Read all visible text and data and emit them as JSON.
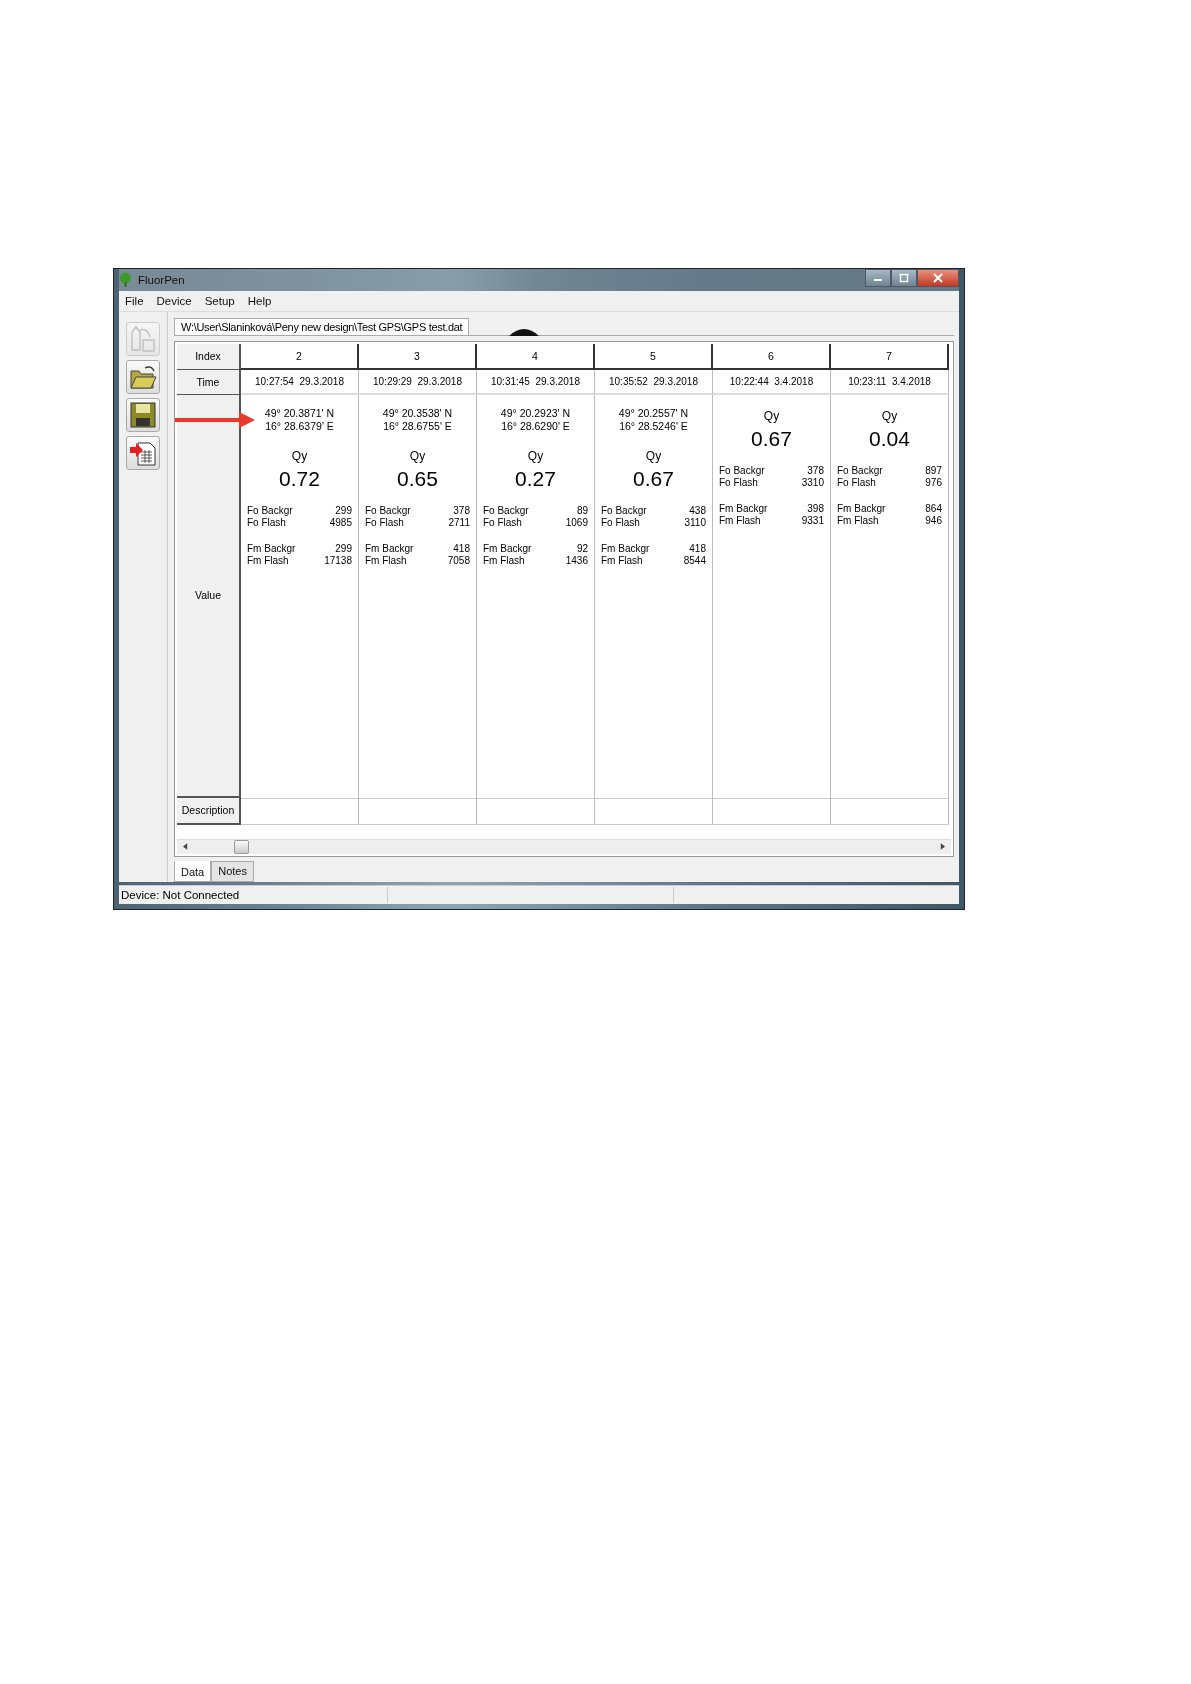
{
  "window": {
    "title": "FluorPen"
  },
  "menu": [
    "File",
    "Device",
    "Setup",
    "Help"
  ],
  "toolbar": [
    {
      "kind": "transfer",
      "disabled": true
    },
    {
      "kind": "open",
      "disabled": false
    },
    {
      "kind": "save",
      "disabled": false
    },
    {
      "kind": "export",
      "disabled": false
    }
  ],
  "file_tab": {
    "label": "W:\\User\\Slaninková\\Peny new design\\Test GPS\\GPS test.dat",
    "selected": true
  },
  "table": {
    "row_headers": {
      "index": "Index",
      "time": "Time",
      "value": "Value",
      "description": "Description"
    },
    "columns": [
      {
        "index": "2",
        "time": "10:27:54  29.3.2018",
        "gps": [
          "49° 20.3871' N",
          "16° 28.6379' E"
        ],
        "arrow": true,
        "qy_label": "Qy",
        "qy": "0.72",
        "groups": [
          [
            {
              "label": "Fo Backgr",
              "value": "299"
            },
            {
              "label": "Fo Flash",
              "value": "4985"
            }
          ],
          [
            {
              "label": "Fm Backgr",
              "value": "299"
            },
            {
              "label": "Fm Flash",
              "value": "17138"
            }
          ]
        ]
      },
      {
        "index": "3",
        "time": "10:29:29  29.3.2018",
        "gps": [
          "49° 20.3538' N",
          "16° 28.6755' E"
        ],
        "arrow": false,
        "qy_label": "Qy",
        "qy": "0.65",
        "groups": [
          [
            {
              "label": "Fo Backgr",
              "value": "378"
            },
            {
              "label": "Fo Flash",
              "value": "2711"
            }
          ],
          [
            {
              "label": "Fm Backgr",
              "value": "418"
            },
            {
              "label": "Fm Flash",
              "value": "7058"
            }
          ]
        ]
      },
      {
        "index": "4",
        "time": "10:31:45  29.3.2018",
        "gps": [
          "49° 20.2923' N",
          "16° 28.6290' E"
        ],
        "arrow": false,
        "qy_label": "Qy",
        "qy": "0.27",
        "groups": [
          [
            {
              "label": "Fo Backgr",
              "value": "89"
            },
            {
              "label": "Fo Flash",
              "value": "1069"
            }
          ],
          [
            {
              "label": "Fm Backgr",
              "value": "92"
            },
            {
              "label": "Fm Flash",
              "value": "1436"
            }
          ]
        ]
      },
      {
        "index": "5",
        "time": "10:35:52  29.3.2018",
        "gps": [
          "49° 20.2557' N",
          "16° 28.5246' E"
        ],
        "arrow": false,
        "qy_label": "Qy",
        "qy": "0.67",
        "groups": [
          [
            {
              "label": "Fo Backgr",
              "value": "438"
            },
            {
              "label": "Fo Flash",
              "value": "3110"
            }
          ],
          [
            {
              "label": "Fm Backgr",
              "value": "418"
            },
            {
              "label": "Fm Flash",
              "value": "8544"
            }
          ]
        ]
      },
      {
        "index": "6",
        "time": "10:22:44  3.4.2018",
        "arrow": false,
        "qy_label": "Qy",
        "qy": "0.67",
        "groups": [
          [
            {
              "label": "Fo Backgr",
              "value": "378"
            },
            {
              "label": "Fo Flash",
              "value": "3310"
            }
          ],
          [
            {
              "label": "Fm Backgr",
              "value": "398"
            },
            {
              "label": "Fm Flash",
              "value": "9331"
            }
          ]
        ]
      },
      {
        "index": "7",
        "time": "10:23:11  3.4.2018",
        "arrow": false,
        "qy_label": "Qy",
        "qy": "0.04",
        "groups": [
          [
            {
              "label": "Fo Backgr",
              "value": "897"
            },
            {
              "label": "Fo Flash",
              "value": "976"
            }
          ],
          [
            {
              "label": "Fm Backgr",
              "value": "864"
            },
            {
              "label": "Fm Flash",
              "value": "946"
            }
          ]
        ]
      }
    ]
  },
  "bottom_tabs": [
    {
      "label": "Data",
      "selected": true
    },
    {
      "label": "Notes",
      "selected": false
    }
  ],
  "status_bar": "Device: Not Connected"
}
